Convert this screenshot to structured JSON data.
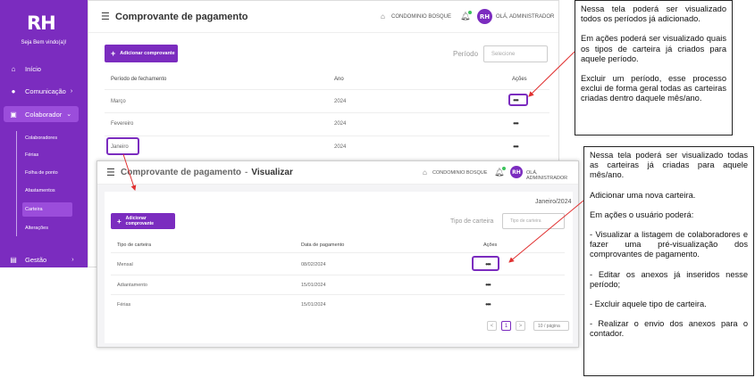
{
  "app": {
    "logo": "RH",
    "welcome": "Seja Bem vindo(a)!"
  },
  "sidebar": {
    "items": [
      {
        "label": "Início",
        "icon": "home-icon"
      },
      {
        "label": "Comunicação",
        "icon": "chat-icon"
      },
      {
        "label": "Colaborador",
        "icon": "id-card-icon"
      },
      {
        "label": "Gestão",
        "icon": "briefcase-icon"
      }
    ],
    "sub_items": [
      "Colaboradores",
      "Férias",
      "Folha de ponto",
      "Afastamentos",
      "Carteira",
      "Alterações"
    ]
  },
  "header": {
    "condo": "CONDOMINIO BOSQUE",
    "greeting": "OLÁ, ADMINISTRADOR",
    "avatar": "RH"
  },
  "screen1": {
    "title": "Comprovante de pagamento",
    "add_button": "Adicionar comprovante",
    "filter_label": "Período",
    "filter_placeholder": "Selecione",
    "columns": [
      "Período de fechamento",
      "Ano",
      "Ações"
    ],
    "rows": [
      {
        "period": "Março",
        "year": "2024",
        "actions": "•••"
      },
      {
        "period": "Fevereiro",
        "year": "2024",
        "actions": "•••"
      },
      {
        "period": "Janeiro",
        "year": "2024",
        "actions": "•••"
      }
    ]
  },
  "screen2": {
    "title": "Comprovante de pagamento",
    "separator": "-",
    "subtitle": "Visualizar",
    "period_label": "Janeiro/2024",
    "add_button": "Adicionar comprovante",
    "filter_label": "Tipo de carteira",
    "filter_placeholder": "Tipo de carteira",
    "columns": [
      "Tipo de carteira",
      "Data de pagamento",
      "Ações"
    ],
    "rows": [
      {
        "type": "Mensal",
        "date": "08/02/2024",
        "actions": "•••"
      },
      {
        "type": "Adiantamento",
        "date": "15/01/2024",
        "actions": "•••"
      },
      {
        "type": "Férias",
        "date": "15/01/2024",
        "actions": "•••"
      }
    ],
    "pagination": {
      "prev": "<",
      "current": "1",
      "next": ">",
      "page_size": "10 / página"
    }
  },
  "notes": {
    "note1": [
      "Nessa tela poderá ser visualizado todos os períodos já adicionado.",
      "Em ações poderá ser visualizado quais os tipos de carteira já criados para aquele período.",
      "Excluir um período, esse processo exclui de forma geral todas as carteiras criadas dentro daquele mês/ano."
    ],
    "note2": [
      "Nessa tela poderá ser visualizado todas as carteiras já criadas para aquele mês/ano.",
      "Adicionar uma nova carteira.",
      "Em ações o usuário poderá:",
      "- Visualizar a listagem de colaboradores e fazer uma pré-visualização dos comprovantes de pagamento.",
      "- Editar os anexos já inseridos nesse período;",
      "- Excluir aquele tipo de carteira.",
      "- Realizar o envio dos anexos para o contador."
    ]
  },
  "colors": {
    "brand": "#7b2cbf",
    "arrow": "#e03030",
    "status_online": "#3cc35c"
  }
}
